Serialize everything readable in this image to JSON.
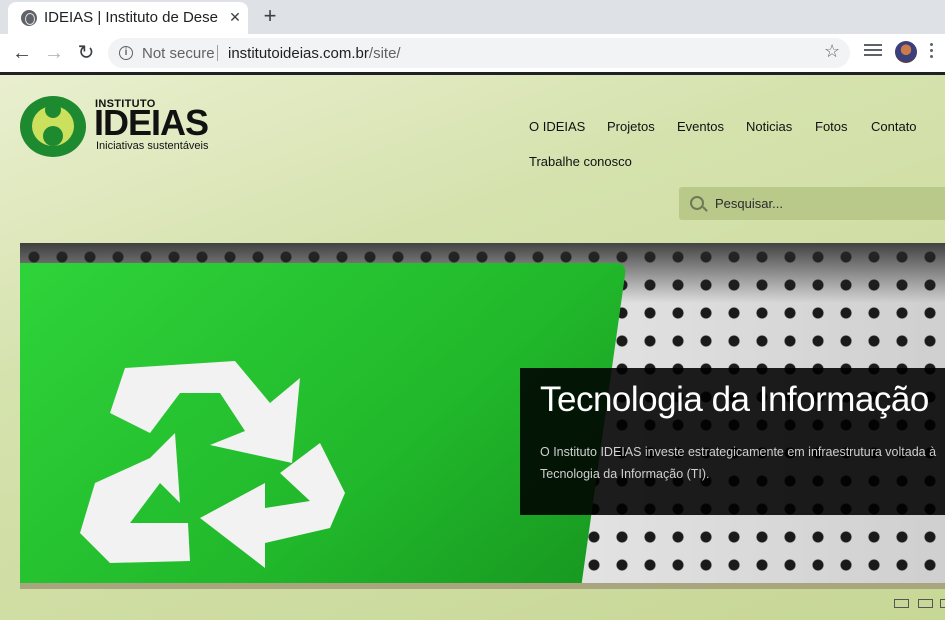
{
  "browser": {
    "tab_title": "IDEIAS | Instituto de Dese",
    "tab_close": "✕",
    "new_tab": "+",
    "security_label": "Not secure",
    "url_host": "institutoideias.com.br",
    "url_path": "/site/"
  },
  "site": {
    "logo": {
      "small_text": "INSTITUTO",
      "name": "IDEIAS",
      "tagline": "Iniciativas sustentáveis"
    },
    "nav": [
      "O IDEIAS",
      "Projetos",
      "Eventos",
      "Noticias",
      "Fotos",
      "Contato",
      "Trabalhe conosco"
    ],
    "search_placeholder": "Pesquisar...",
    "slide": {
      "title": "Tecnologia da Informação",
      "text": "O Instituto IDEIAS investe estrategicamente em infraestrutura voltada à Tecnologia da Informação (TI)."
    },
    "slider_dots": 3
  },
  "colors": {
    "page_bg": "#d5e2ad",
    "logo_green": "#1d8a2f",
    "key_green": "#21b82b",
    "caption_bg": "#000000"
  },
  "icons": [
    "globe-icon",
    "close-icon",
    "plus-icon",
    "back-icon",
    "forward-icon",
    "reload-icon",
    "info-icon",
    "star-icon",
    "media-icon",
    "avatar",
    "menu-icon",
    "search-icon",
    "recycle-icon"
  ]
}
